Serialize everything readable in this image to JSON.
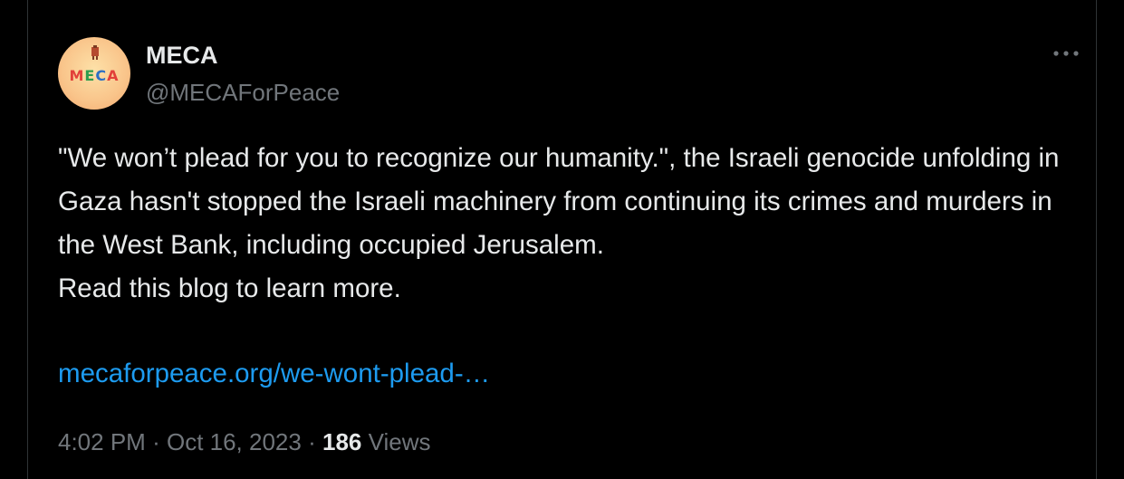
{
  "user": {
    "display_name": "MECA",
    "handle": "@MECAForPeace",
    "avatar": {
      "letters": [
        "M",
        "E",
        "C",
        "A"
      ],
      "icon": "meca-logo-icon",
      "colors": {
        "background": "#f9c48a",
        "red": "#e2403a",
        "green": "#2e9c4e",
        "blue": "#2b6fc4"
      }
    }
  },
  "more_icon": "more-horizontal-icon",
  "tweet": {
    "text": "\"We won’t plead for you to recognize our humanity.\", the Israeli genocide unfolding in Gaza hasn't stopped the Israeli machinery from continuing its crimes and murders in the West Bank, including occupied Jerusalem.\nRead this blog to learn more.",
    "link": "mecaforpeace.org/we-wont-plead-…",
    "time": "4:02 PM",
    "separator": "·",
    "date": "Oct 16, 2023",
    "views_count": "186",
    "views_label": "Views"
  },
  "colors": {
    "background": "#000000",
    "primary_text": "#e7e9ea",
    "secondary_text": "#71767b",
    "link": "#1d9bf0",
    "border": "#2f3336"
  }
}
